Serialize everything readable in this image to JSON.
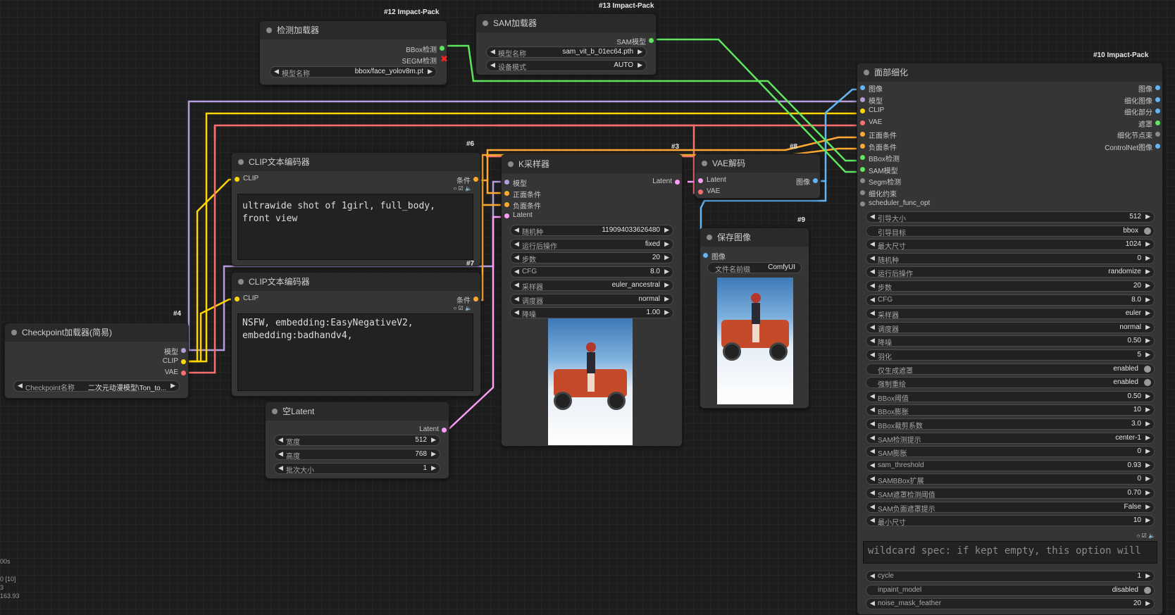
{
  "colors": {
    "model": "#b39ddb",
    "clip": "#ffd500",
    "vae": "#ff6e6e",
    "conditioning": "#ffa931",
    "latent": "#ff9cf9",
    "image": "#64b5f6",
    "sam": "#5ee65e",
    "bbox": "#5ee65e"
  },
  "nodes": {
    "detector": {
      "badge": "#12 Impact-Pack",
      "title": "检测加载器",
      "out_bbox": "BBox检测",
      "out_segm": "SEGM检测",
      "w_model_label": "模型名称",
      "w_model_value": "bbox/face_yolov8m.pt"
    },
    "sam": {
      "badge": "#13 Impact-Pack",
      "title": "SAM加载器",
      "out_sam": "SAM模型",
      "w_model_label": "模型名称",
      "w_model_value": "sam_vit_b_01ec64.pth",
      "w_device_label": "设备模式",
      "w_device_value": "AUTO"
    },
    "clip1": {
      "badge": "#6",
      "title": "CLIP文本编码器",
      "in_clip": "CLIP",
      "out_cond": "条件",
      "text": "ultrawide shot of 1girl, full_body,\nfront view"
    },
    "clip2": {
      "badge": "#7",
      "title": "CLIP文本编码器",
      "in_clip": "CLIP",
      "out_cond": "条件",
      "text": "NSFW, embedding:EasyNegativeV2,\nembedding:badhandv4,"
    },
    "checkpoint": {
      "badge": "#4",
      "title": "Checkpoint加载器(简易)",
      "out_model": "模型",
      "out_clip": "CLIP",
      "out_vae": "VAE",
      "w_ckpt_label": "Checkpoint名称",
      "w_ckpt_value": "二次元动漫模型\\Ton_to..."
    },
    "latent": {
      "title": "空Latent",
      "out_latent": "Latent",
      "w_width_label": "宽度",
      "w_width_value": "512",
      "w_height_label": "高度",
      "w_height_value": "768",
      "w_batch_label": "批次大小",
      "w_batch_value": "1"
    },
    "ksampler": {
      "badge": "#3",
      "title": "K采样器",
      "in_model": "模型",
      "in_pos": "正面条件",
      "in_neg": "负面条件",
      "in_latent": "Latent",
      "out_latent": "Latent",
      "widgets": [
        {
          "label": "随机种",
          "value": "119094033626480"
        },
        {
          "label": "运行后操作",
          "value": "fixed"
        },
        {
          "label": "步数",
          "value": "20"
        },
        {
          "label": "CFG",
          "value": "8.0"
        },
        {
          "label": "采样器",
          "value": "euler_ancestral"
        },
        {
          "label": "调度器",
          "value": "normal"
        },
        {
          "label": "降噪",
          "value": "1.00"
        }
      ]
    },
    "vae": {
      "badge": "#8",
      "title": "VAE解码",
      "in_latent": "Latent",
      "in_vae": "VAE",
      "out_image": "图像"
    },
    "save": {
      "badge": "#9",
      "title": "保存图像",
      "in_image": "图像",
      "w_prefix_label": "文件名前缀",
      "w_prefix_value": "ComfyUI"
    },
    "facedetail": {
      "badge": "#10 Impact-Pack",
      "title": "面部细化",
      "inputs": [
        "图像",
        "模型",
        "CLIP",
        "VAE",
        "正面条件",
        "负面条件",
        "BBox检测",
        "SAM模型",
        "Segm检测",
        "细化约束",
        "scheduler_func_opt"
      ],
      "outputs": [
        "图像",
        "细化图像",
        "细化部分",
        "遮罩",
        "细化节点束",
        "ControlNet图像"
      ],
      "widgets": [
        {
          "label": "引导大小",
          "value": "512"
        },
        {
          "label": "引导目标",
          "value": "bbox",
          "toggle": true
        },
        {
          "label": "最大尺寸",
          "value": "1024"
        },
        {
          "label": "随机种",
          "value": "0"
        },
        {
          "label": "运行后操作",
          "value": "randomize"
        },
        {
          "label": "步数",
          "value": "20"
        },
        {
          "label": "CFG",
          "value": "8.0"
        },
        {
          "label": "采样器",
          "value": "euler"
        },
        {
          "label": "调度器",
          "value": "normal"
        },
        {
          "label": "降噪",
          "value": "0.50"
        },
        {
          "label": "羽化",
          "value": "5"
        },
        {
          "label": "仅生成遮罩",
          "value": "enabled",
          "toggle": true
        },
        {
          "label": "强制重绘",
          "value": "enabled",
          "toggle": true
        },
        {
          "label": "BBox阈值",
          "value": "0.50"
        },
        {
          "label": "BBox膨胀",
          "value": "10"
        },
        {
          "label": "BBox裁剪系数",
          "value": "3.0"
        },
        {
          "label": "SAM检测提示",
          "value": "center-1"
        },
        {
          "label": "SAM膨胀",
          "value": "0"
        },
        {
          "label": "sam_threshold",
          "value": "0.93"
        },
        {
          "label": "SAMBBox扩展",
          "value": "0"
        },
        {
          "label": "SAM遮罩检测阈值",
          "value": "0.70"
        },
        {
          "label": "SAM负面遮罩提示",
          "value": "False"
        },
        {
          "label": "最小尺寸",
          "value": "10"
        }
      ],
      "placeholder": "wildcard spec: if kept empty, this option will",
      "tail_widgets": [
        {
          "label": "cycle",
          "value": "1"
        },
        {
          "label": "inpaint_model",
          "value": "disabled",
          "toggle": true
        },
        {
          "label": "noise_mask_feather",
          "value": "20"
        }
      ]
    }
  },
  "status": {
    "line1": "00s",
    "line2": "0 [10]",
    "line3": "3",
    "line4": "163.93"
  }
}
